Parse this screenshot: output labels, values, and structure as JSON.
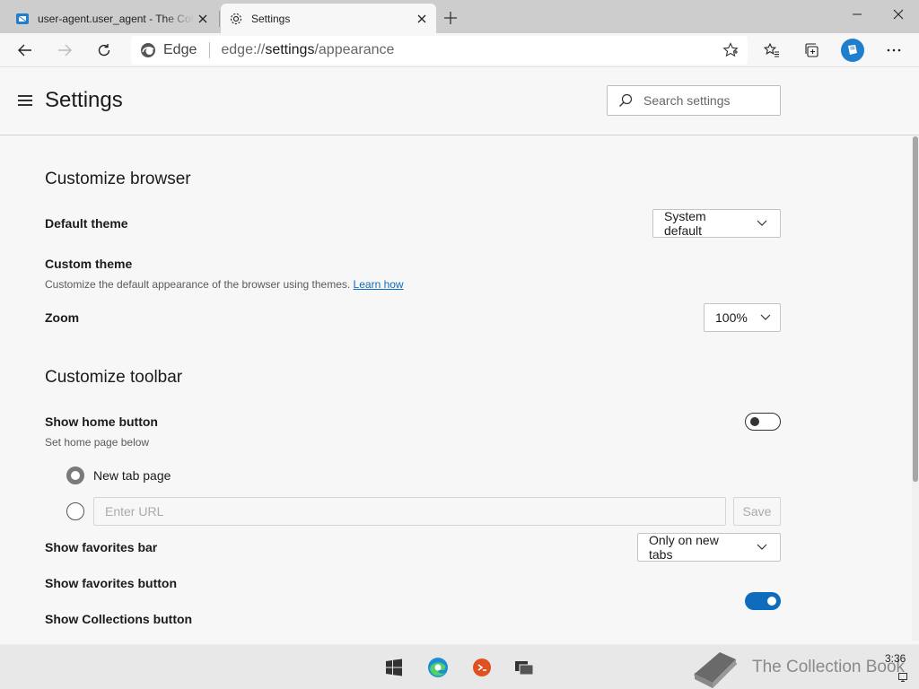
{
  "tabs": [
    {
      "title": "user-agent.user_agent - The Coll",
      "icon": "book-icon",
      "active": false
    },
    {
      "title": "Settings",
      "icon": "gear-icon",
      "active": true
    }
  ],
  "toolbar": {
    "brand": "Edge",
    "url_scheme": "edge://",
    "url_host": "settings",
    "url_path": "/appearance"
  },
  "header": {
    "title": "Settings",
    "search_placeholder": "Search settings"
  },
  "customize_browser": {
    "title": "Customize browser",
    "default_theme_label": "Default theme",
    "default_theme_value": "System default",
    "custom_theme_label": "Custom theme",
    "custom_theme_desc": "Customize the default appearance of the browser using themes.",
    "custom_theme_link": "Learn how",
    "zoom_label": "Zoom",
    "zoom_value": "100%"
  },
  "customize_toolbar": {
    "title": "Customize toolbar",
    "home_button_label": "Show home button",
    "home_button_on": false,
    "home_button_desc": "Set home page below",
    "new_tab_option": "New tab page",
    "url_placeholder": "Enter URL",
    "save_label": "Save",
    "favorites_bar_label": "Show favorites bar",
    "favorites_bar_value": "Only on new tabs",
    "favorites_button_label": "Show favorites button",
    "favorites_button_on": true,
    "collections_button_label": "Show Collections button",
    "collections_button_on": true
  },
  "taskbar": {
    "watermark": "The Collection Book",
    "clock": "3:36"
  },
  "colors": {
    "accent": "#0f6cbd",
    "tabstrip": "#cdcdcd",
    "background": "#f7f7f7"
  }
}
